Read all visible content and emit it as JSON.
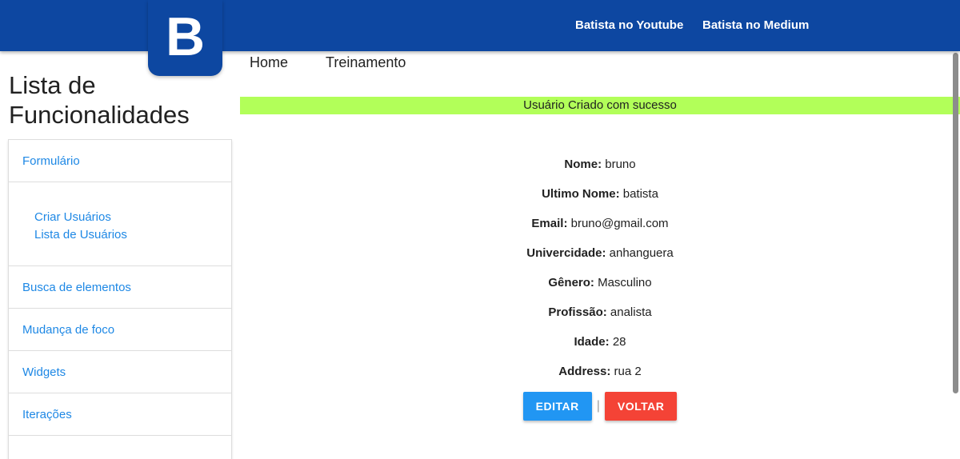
{
  "header": {
    "logo_letter": "B",
    "links": [
      {
        "label": "Batista no Youtube"
      },
      {
        "label": "Batista no Medium"
      }
    ],
    "bg_color": "#0d47a1"
  },
  "nav": {
    "home": "Home",
    "training": "Treinamento"
  },
  "sidebar": {
    "title": "Lista de Funcionalidades",
    "items": [
      {
        "label": "Formulário"
      },
      {
        "label": "Busca de elementos"
      },
      {
        "label": "Mudança de foco"
      },
      {
        "label": "Widgets"
      },
      {
        "label": "Iterações"
      }
    ],
    "submenu": [
      {
        "label": "Criar Usuários"
      },
      {
        "label": "Lista de Usuários"
      }
    ],
    "link_color": "#1e88e5"
  },
  "alert": {
    "message": "Usuário Criado com sucesso",
    "color": "#b2ff59"
  },
  "user": {
    "fields": [
      {
        "label": "Nome:",
        "value": "bruno"
      },
      {
        "label": "Ultimo Nome:",
        "value": "batista"
      },
      {
        "label": "Email:",
        "value": "bruno@gmail.com"
      },
      {
        "label": "Univercidade:",
        "value": "anhanguera"
      },
      {
        "label": "Gênero:",
        "value": "Masculino"
      },
      {
        "label": "Profissão:",
        "value": "analista"
      },
      {
        "label": "Idade:",
        "value": "28"
      },
      {
        "label": "Address:",
        "value": "rua 2"
      }
    ]
  },
  "actions": {
    "edit_label": "Editar",
    "separator": "|",
    "back_label": "Voltar",
    "edit_color": "#2196f3",
    "back_color": "#f44336"
  }
}
